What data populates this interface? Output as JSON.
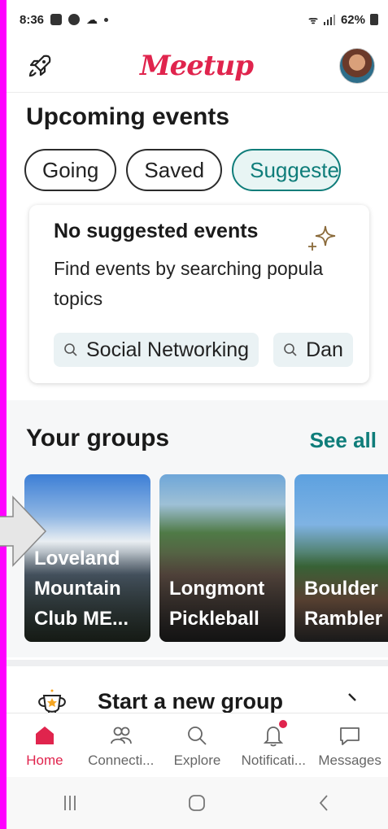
{
  "status_bar": {
    "time": "8:36",
    "battery": "62%",
    "icons": [
      "gallery-icon",
      "news-icon",
      "cloud-icon",
      "dot-icon",
      "wifi-icon",
      "signal-icon",
      "battery-icon"
    ]
  },
  "app_bar": {
    "logo": "Meetup",
    "left_icon": "rocket-icon",
    "avatar": "profile-avatar"
  },
  "upcoming": {
    "heading": "Upcoming events",
    "chips": [
      "Going",
      "Saved",
      "Suggeste"
    ],
    "active_chip": "Suggeste"
  },
  "empty_card": {
    "title": "No suggested events",
    "text": "Find events by searching popula topics",
    "text_line1": "Find events by searching popula",
    "text_line2": "topics",
    "topics": [
      "Social Networking",
      "Dan"
    ]
  },
  "groups": {
    "heading": "Your groups",
    "see_all": "See all",
    "items": [
      {
        "name_line1": "Loveland",
        "name_line2": "Mountain",
        "name_line3": "Club ME..."
      },
      {
        "name_line1": "Longmont",
        "name_line2": "Pickleball"
      },
      {
        "name_line1": "Boulder",
        "name_line2": "Rambler"
      }
    ]
  },
  "start_group": {
    "label": "Start a new group"
  },
  "bottom_nav": {
    "items": [
      {
        "label": "Home",
        "icon": "home-icon"
      },
      {
        "label": "Connecti...",
        "icon": "people-icon"
      },
      {
        "label": "Explore",
        "icon": "search-icon"
      },
      {
        "label": "Notificati...",
        "icon": "bell-icon"
      },
      {
        "label": "Messages",
        "icon": "chat-icon"
      }
    ]
  },
  "colors": {
    "brand": "#e0244d",
    "accent": "#0f7d7a",
    "frame": "#ff00ff"
  }
}
